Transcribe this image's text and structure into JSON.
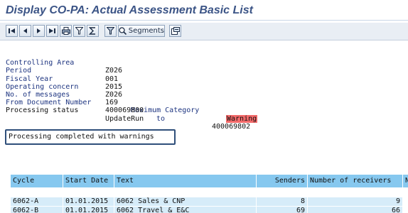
{
  "title": "Display CO-PA: Actual Assessment Basic List",
  "toolbar": {
    "segments_label": "Segments",
    "icons": [
      "first-page-icon",
      "prev-page-icon",
      "next-page-icon",
      "last-page-icon",
      "print-icon",
      "filter-icon",
      "sum-icon",
      "filter-set-icon",
      "search-icon",
      "segments-icon",
      "export-icon"
    ]
  },
  "info": {
    "rows": [
      {
        "label": "Controlling Area",
        "value": "Z026"
      },
      {
        "label": "Period",
        "value": "001"
      },
      {
        "label": "Fiscal Year",
        "value": "2015"
      },
      {
        "label": "Operating concern",
        "value": "Z026"
      },
      {
        "label": "No. of messages",
        "value": "169",
        "extra_label": "Maximum Category",
        "extra_value": "Warning"
      },
      {
        "label": "From Document Number",
        "value": "400069800",
        "to_label": "to",
        "to_value": "400069802"
      },
      {
        "label": "Processing status",
        "value": "UpdateRun"
      }
    ]
  },
  "message": "Processing completed with warnings",
  "table": {
    "headers": [
      "Cycle",
      "Start Date",
      "Text",
      "Senders",
      "Number of receivers",
      "N"
    ],
    "rows": [
      [
        "6062-A",
        "01.01.2015",
        "6062 Sales & CNP",
        "8",
        "9"
      ],
      [
        "6062-B",
        "01.01.2015",
        "6062 Travel & E&C",
        "69",
        "66"
      ]
    ]
  },
  "colors": {
    "title": "#3b5486",
    "header_bg": "#86c8ef",
    "row_bg": "#d6ecf9",
    "warning_bg": "#f26a6a"
  }
}
